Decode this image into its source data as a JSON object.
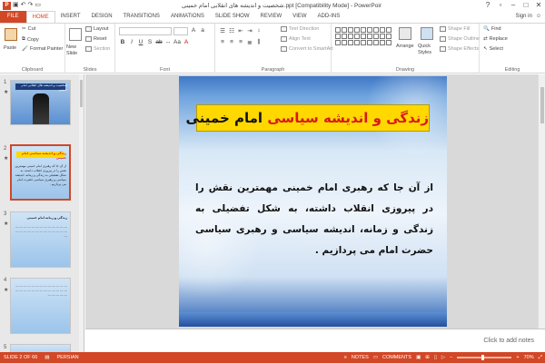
{
  "window": {
    "title": "شخصیت و اندیشه های انقلابی امام خمینی.ppt [Compatibility Mode] - PowerPoint",
    "signin": "Sign in"
  },
  "qat": {
    "icons": [
      "powerpoint-logo-icon",
      "save-icon",
      "undo-icon",
      "redo-icon",
      "present-icon"
    ]
  },
  "tabs": [
    "FILE",
    "HOME",
    "INSERT",
    "DESIGN",
    "TRANSITIONS",
    "ANIMATIONS",
    "SLIDE SHOW",
    "REVIEW",
    "VIEW",
    "ADD-INS"
  ],
  "active_tab": "HOME",
  "ribbon": {
    "clipboard": {
      "label": "Clipboard",
      "paste": "Paste",
      "cut": "Cut",
      "copy": "Copy",
      "format_painter": "Format Painter"
    },
    "slides": {
      "label": "Slides",
      "new_slide": "New Slide",
      "layout": "Layout",
      "reset": "Reset",
      "section": "Section"
    },
    "font": {
      "label": "Font"
    },
    "paragraph": {
      "label": "Paragraph",
      "text_direction": "Text Direction",
      "align_text": "Align Text",
      "convert": "Convert to SmartArt"
    },
    "drawing": {
      "label": "Drawing",
      "arrange": "Arrange",
      "quick_styles": "Quick Styles",
      "shape_fill": "Shape Fill",
      "shape_outline": "Shape Outline",
      "shape_effects": "Shape Effects"
    },
    "editing": {
      "label": "Editing",
      "find": "Find",
      "replace": "Replace",
      "select": "Select"
    }
  },
  "thumbnails": [
    {
      "num": "1",
      "star": "★",
      "title": "شخصیت و اندیشه های انقلابی امام خمینی"
    },
    {
      "num": "2",
      "star": "★",
      "title": "زندگی و اندیشه سیاسی امام خمینی",
      "selected": true
    },
    {
      "num": "3",
      "star": "★",
      "title": "زندگی و زمانه امام خمینی"
    },
    {
      "num": "4",
      "star": "★",
      "title": ""
    },
    {
      "num": "5",
      "star": "",
      "title": ""
    }
  ],
  "slide": {
    "title_part1": "زندگی و اندیشه سیاسی",
    "title_part2": "امام خمینی",
    "body": "از آن جا که رهبری امام خمینی مهمترین نقش را در پیروزی انقلاب داشته، به شکل تفضیلی به زندگی و زمانه، اندیشه سیاسی و رهبری سیاسی حضرت امام می پردازیم ."
  },
  "notes_placeholder": "Click to add notes",
  "status": {
    "slide_info": "SLIDE 2 OF 66",
    "language": "PERSIAN",
    "notes": "NOTES",
    "comments": "COMMENTS",
    "zoom": "70%"
  },
  "colors": {
    "accent": "#d24726",
    "title_bg": "#ffd800",
    "title_red": "#d7191c"
  }
}
